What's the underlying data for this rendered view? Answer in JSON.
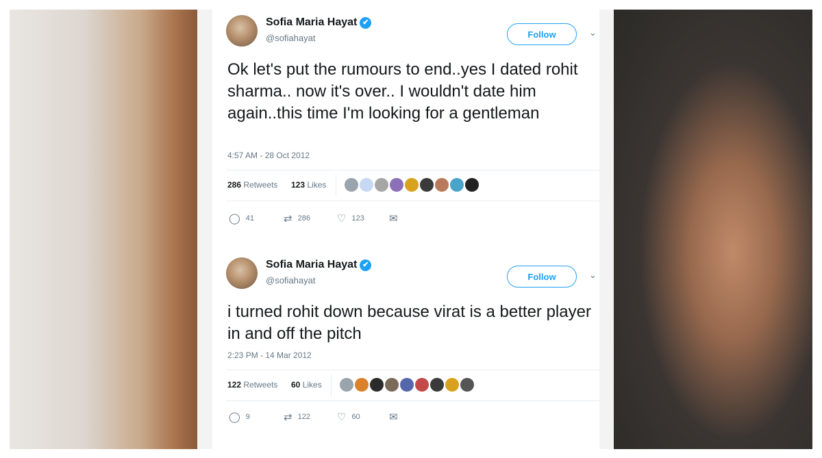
{
  "tweets": [
    {
      "name": "Sofia Maria Hayat",
      "handle": "@sofiahayat",
      "follow_label": "Follow",
      "text": "Ok let's put the rumours to end..yes I dated rohit sharma.. now it's over.. I wouldn't date him again..this time I'm looking for a gentleman",
      "time": "4:57 AM - 28 Oct 2012",
      "retweets_count": "286",
      "retweets_label": "Retweets",
      "likes_count": "123",
      "likes_label": "Likes",
      "replies": "41",
      "retweet_action": "286",
      "like_action": "123",
      "liker_colors": [
        "#9aa4ad",
        "#c7d8f2",
        "#a6a6a6",
        "#8b6fb8",
        "#d8a21e",
        "#3a3a3a",
        "#b87a5a",
        "#4aa3c8",
        "#222222"
      ]
    },
    {
      "name": "Sofia Maria Hayat",
      "handle": "@sofiahayat",
      "follow_label": "Follow",
      "text": "i turned rohit down because virat is a better player in and off the pitch",
      "time": "2:23 PM - 14 Mar 2012",
      "retweets_count": "122",
      "retweets_label": "Retweets",
      "likes_count": "60",
      "likes_label": "Likes",
      "replies": "9",
      "retweet_action": "122",
      "like_action": "60",
      "liker_colors": [
        "#9aa4ad",
        "#d9822b",
        "#2b2b2b",
        "#7a6a5a",
        "#5566aa",
        "#c44a4a",
        "#3a3a3a",
        "#d8a21e",
        "#555555"
      ]
    }
  ],
  "colors": {
    "accent": "#1da1f2",
    "muted": "#657786",
    "text": "#14171a",
    "border": "#e6ecf0"
  },
  "icons": {
    "verified": "✔",
    "chevron": "⌄",
    "reply": "◯",
    "retweet": "⇄",
    "like": "♡",
    "dm": "✉"
  }
}
